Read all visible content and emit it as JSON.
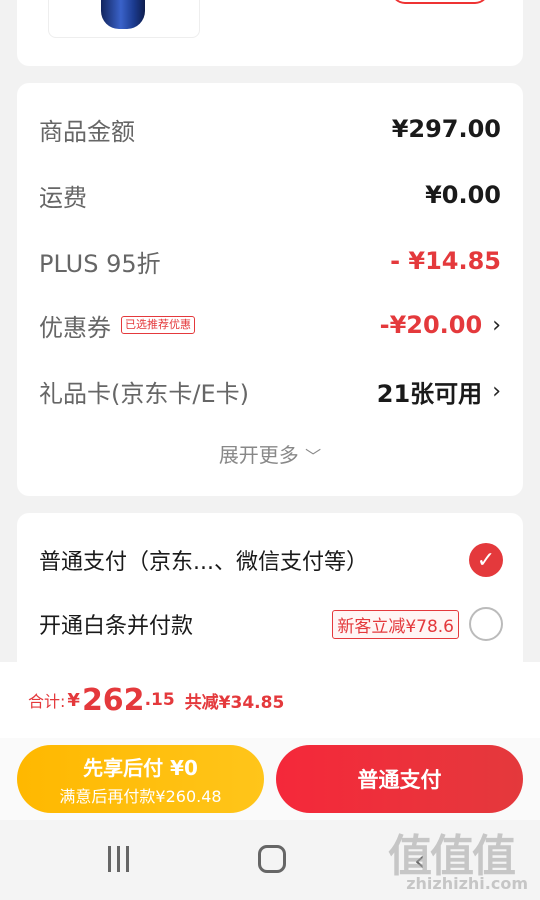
{
  "colors": {
    "accent_red": "#e4393c",
    "accent_yellow": "#ffb800",
    "background": "#f2f2f2"
  },
  "price_breakdown": {
    "goods": {
      "label": "商品金额",
      "value": "¥297.00"
    },
    "shipping": {
      "label": "运费",
      "value": "¥0.00"
    },
    "plus": {
      "label": "PLUS 95折",
      "value": "- ¥14.85"
    },
    "coupon": {
      "label": "优惠券",
      "tag": "已选推荐优惠",
      "value": "-¥20.00",
      "icon": "chevron-right-icon"
    },
    "giftcard": {
      "label": "礼品卡(京东卡/E卡)",
      "value": "21张可用",
      "icon": "chevron-right-icon"
    },
    "expand_label": "展开更多",
    "expand_icon": "chevron-down-icon"
  },
  "payment": {
    "normal": {
      "label": "普通支付（京东...、微信支付等）",
      "selected": true,
      "icon": "checkmark-icon"
    },
    "baitiao": {
      "label": "开通白条并付款",
      "promo": "新客立减¥78.6",
      "selected": false
    }
  },
  "total": {
    "label": "合计:",
    "currency": "¥",
    "integer": "262",
    "decimal": ".15",
    "saved": "共减¥34.85"
  },
  "actions": {
    "pay_later_main": "先享后付 ¥0",
    "pay_later_sub": "满意后再付款¥260.48",
    "pay_now": "普通支付"
  },
  "watermark": {
    "logo": "值值值",
    "url": "zhizhizhi.com"
  }
}
